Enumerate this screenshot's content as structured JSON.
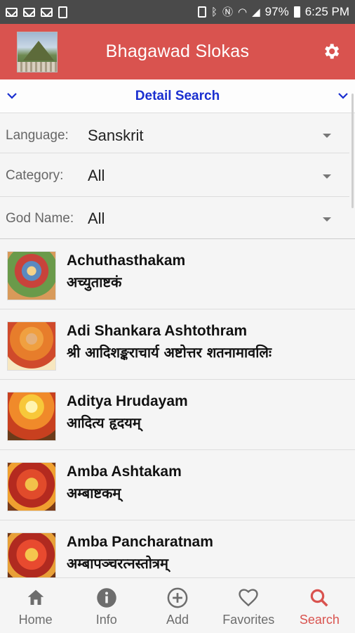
{
  "status_bar": {
    "battery": "97%",
    "time": "6:25 PM"
  },
  "app_bar": {
    "title": "Bhagawad Slokas"
  },
  "detail_search": {
    "title": "Detail Search"
  },
  "filters": [
    {
      "label": "Language:",
      "value": "Sanskrit"
    },
    {
      "label": "Category:",
      "value": "All"
    },
    {
      "label": "God Name:",
      "value": "All"
    }
  ],
  "slokas": [
    {
      "name": "Achuthasthakam",
      "sanskrit": "अच्युताष्टकं"
    },
    {
      "name": "Adi Shankara Ashtothram",
      "sanskrit": "श्री आदिशङ्कराचार्य अष्टोत्तर शतनामावलिः"
    },
    {
      "name": "Aditya Hrudayam",
      "sanskrit": "आदित्य हृदयम्"
    },
    {
      "name": "Amba Ashtakam",
      "sanskrit": "अम्बाष्टकम्"
    },
    {
      "name": "Amba Pancharatnam",
      "sanskrit": "अम्बापञ्चरत्नस्तोत्रम्"
    }
  ],
  "bottom_nav": [
    {
      "label": "Home",
      "icon": "home-icon"
    },
    {
      "label": "Info",
      "icon": "info-icon"
    },
    {
      "label": "Add",
      "icon": "add-circle-icon"
    },
    {
      "label": "Favorites",
      "icon": "heart-icon"
    },
    {
      "label": "Search",
      "icon": "search-icon",
      "active": true
    }
  ],
  "colors": {
    "primary": "#d9534f",
    "link_blue": "#1a2fd0",
    "nav_inactive": "#6d6d6d"
  }
}
